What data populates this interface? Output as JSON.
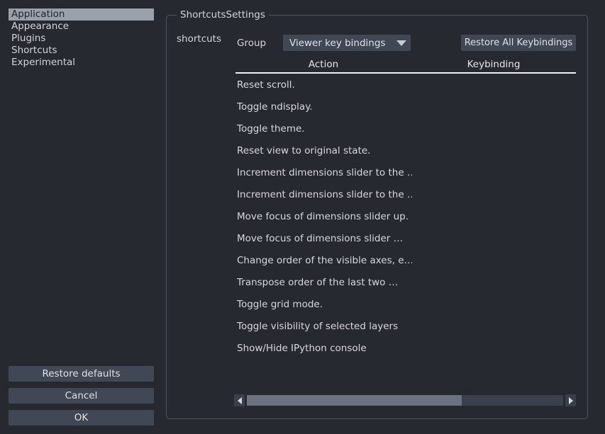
{
  "sidebar": {
    "items": [
      {
        "label": "Application",
        "selected": true
      },
      {
        "label": "Appearance",
        "selected": false
      },
      {
        "label": "Plugins",
        "selected": false
      },
      {
        "label": "Shortcuts",
        "selected": false
      },
      {
        "label": "Experimental",
        "selected": false
      }
    ],
    "buttons": {
      "restore_defaults": "Restore defaults",
      "cancel": "Cancel",
      "ok": "OK"
    }
  },
  "panel": {
    "groupbox_title": "ShortcutsSettings",
    "field_label": "shortcuts",
    "group_label": "Group",
    "group_combo_value": "Viewer key bindings",
    "group_combo_icon": "chevron-down-icon",
    "restore_all_label": "Restore All Keybindings"
  },
  "table": {
    "columns": [
      "Action",
      "Keybinding"
    ],
    "rows": [
      {
        "action": "Reset scroll.",
        "keybinding": ""
      },
      {
        "action": "Toggle ndisplay.",
        "keybinding": ""
      },
      {
        "action": "Toggle theme.",
        "keybinding": ""
      },
      {
        "action": "Reset view to original state.",
        "keybinding": ""
      },
      {
        "action": "Increment dimensions slider to the …",
        "keybinding": ""
      },
      {
        "action": "Increment dimensions slider to the …",
        "keybinding": ""
      },
      {
        "action": "Move focus of dimensions slider up.",
        "keybinding": ""
      },
      {
        "action": "Move focus of dimensions slider …",
        "keybinding": ""
      },
      {
        "action": "Change order of the visible axes, e….",
        "keybinding": ""
      },
      {
        "action": "Transpose order of the last two …",
        "keybinding": ""
      },
      {
        "action": "Toggle grid mode.",
        "keybinding": ""
      },
      {
        "action": "Toggle visibility of selected layers",
        "keybinding": ""
      },
      {
        "action": "Show/Hide IPython console",
        "keybinding": ""
      }
    ]
  },
  "scrollbar": {
    "left_icon": "triangle-left-icon",
    "right_icon": "triangle-right-icon",
    "thumb_percent": 68
  },
  "colors": {
    "background": "#262930",
    "control": "#414855",
    "selection": "#9aa1ab",
    "text": "#d3d5d8",
    "header_rule": "#f0f1f3"
  }
}
